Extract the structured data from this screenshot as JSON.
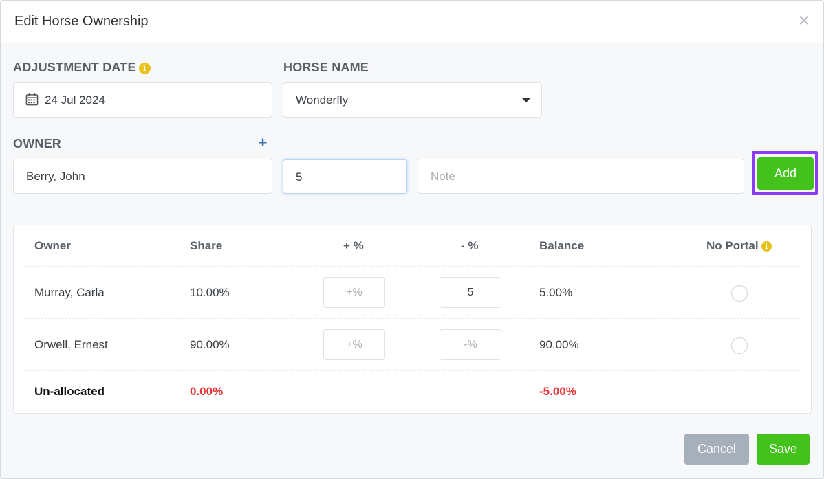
{
  "modal": {
    "title": "Edit Horse Ownership",
    "close_glyph": "×"
  },
  "form": {
    "adjustment_date": {
      "label": "ADJUSTMENT DATE",
      "info_glyph": "i",
      "value": "24 Jul 2024",
      "icon": "calendar-icon"
    },
    "horse_name": {
      "label": "HORSE NAME",
      "value": "Wonderfly"
    },
    "owner": {
      "label": "OWNER",
      "add_glyph": "+",
      "value": "Berry, John"
    },
    "percent": {
      "value": "5"
    },
    "note": {
      "placeholder": "Note"
    },
    "add_label": "Add"
  },
  "table": {
    "headers": {
      "owner": "Owner",
      "share": "Share",
      "plus": "+ %",
      "minus": "- %",
      "balance": "Balance",
      "no_portal": "No Portal",
      "info_glyph": "i"
    },
    "rows": [
      {
        "owner": "Murray, Carla",
        "share": "10.00%",
        "plus_placeholder": "+%",
        "minus_value": "5",
        "balance": "5.00%"
      },
      {
        "owner": "Orwell, Ernest",
        "share": "90.00%",
        "plus_placeholder": "+%",
        "minus_placeholder": "-%",
        "balance": "90.00%"
      }
    ],
    "footer": {
      "label": "Un-allocated",
      "share": "0.00%",
      "balance": "-5.00%"
    }
  },
  "actions": {
    "cancel_label": "Cancel",
    "save_label": "Save"
  },
  "colors": {
    "primary_green": "#43c21b",
    "cancel_gray": "#a7b0ba",
    "negative_red": "#e5383b",
    "info_yellow": "#e8c21a",
    "highlight_purple": "#8b3cf2",
    "plus_blue": "#3b73b4"
  }
}
